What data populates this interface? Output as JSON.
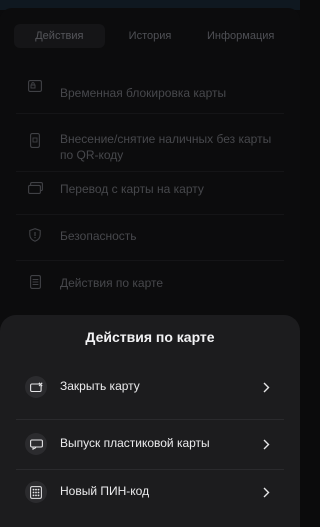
{
  "tabs": [
    {
      "label": "Действия",
      "active": true
    },
    {
      "label": "История",
      "active": false
    },
    {
      "label": "Информация",
      "active": false
    }
  ],
  "menu": [
    {
      "label": "Временная блокировка карты",
      "icon": "lock-card-icon"
    },
    {
      "label": "Внесение/снятие наличных без карты по QR-коду",
      "icon": "phone-qr-icon"
    },
    {
      "label": "Перевод с карты на карту",
      "icon": "card-transfer-icon"
    },
    {
      "label": "Безопасность",
      "icon": "shield-icon"
    },
    {
      "label": "Действия по карте",
      "icon": "document-list-icon"
    }
  ],
  "sheet": {
    "title": "Действия по карте",
    "actions": [
      {
        "label": "Закрыть карту",
        "icon": "close-card-icon"
      },
      {
        "label": "Выпуск пластиковой карты",
        "icon": "plastic-card-icon"
      },
      {
        "label": "Новый ПИН-код",
        "icon": "pin-keypad-icon"
      }
    ]
  },
  "colors": {
    "background": "#0c0c0d",
    "sheet": "#1c1c1e",
    "text_primary": "#f2f2f4",
    "text_dimmed": "#47484c"
  }
}
